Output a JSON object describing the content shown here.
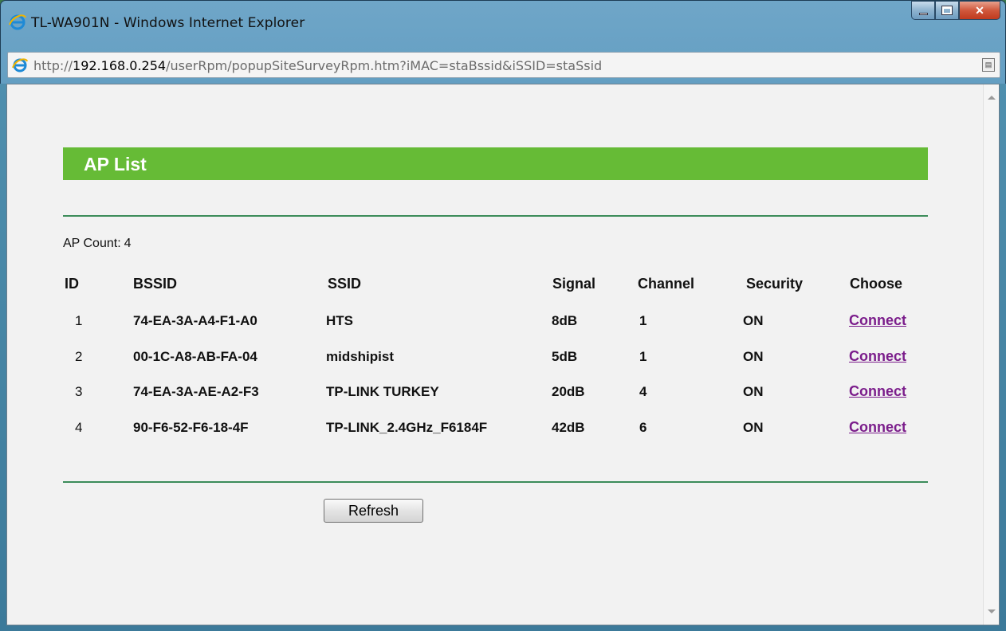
{
  "window": {
    "title": "TL-WA901N - Windows Internet Explorer"
  },
  "address": {
    "prefix": "http://",
    "host": "192.168.0.254",
    "path": "/userRpm/popupSiteSurveyRpm.htm?iMAC=staBssid&iSSID=staSsid"
  },
  "page": {
    "header": "AP List",
    "ap_count_label": "AP Count:",
    "ap_count_value": "4",
    "columns": [
      "ID",
      "BSSID",
      "SSID",
      "Signal",
      "Channel",
      "Security",
      "Choose"
    ],
    "rows": [
      {
        "id": "1",
        "bssid": "74-EA-3A-A4-F1-A0",
        "ssid": "HTS",
        "signal": "8dB",
        "channel": "1",
        "security": "ON",
        "choose": "Connect"
      },
      {
        "id": "2",
        "bssid": "00-1C-A8-AB-FA-04",
        "ssid": "midshipist",
        "signal": "5dB",
        "channel": "1",
        "security": "ON",
        "choose": "Connect"
      },
      {
        "id": "3",
        "bssid": "74-EA-3A-AE-A2-F3",
        "ssid": "TP-LINK TURKEY",
        "signal": "20dB",
        "channel": "4",
        "security": "ON",
        "choose": "Connect"
      },
      {
        "id": "4",
        "bssid": "90-F6-52-F6-18-4F",
        "ssid": "TP-LINK_2.4GHz_F6184F",
        "signal": "42dB",
        "channel": "6",
        "security": "ON",
        "choose": "Connect"
      }
    ],
    "refresh_label": "Refresh"
  },
  "icons": {
    "browser": "ie-icon",
    "page": "page-icon",
    "compat": "compatibility-view-icon"
  },
  "colors": {
    "header_green": "#66bb36",
    "divider_green": "#3c8c5a",
    "link_purple": "#7b1d8b"
  }
}
